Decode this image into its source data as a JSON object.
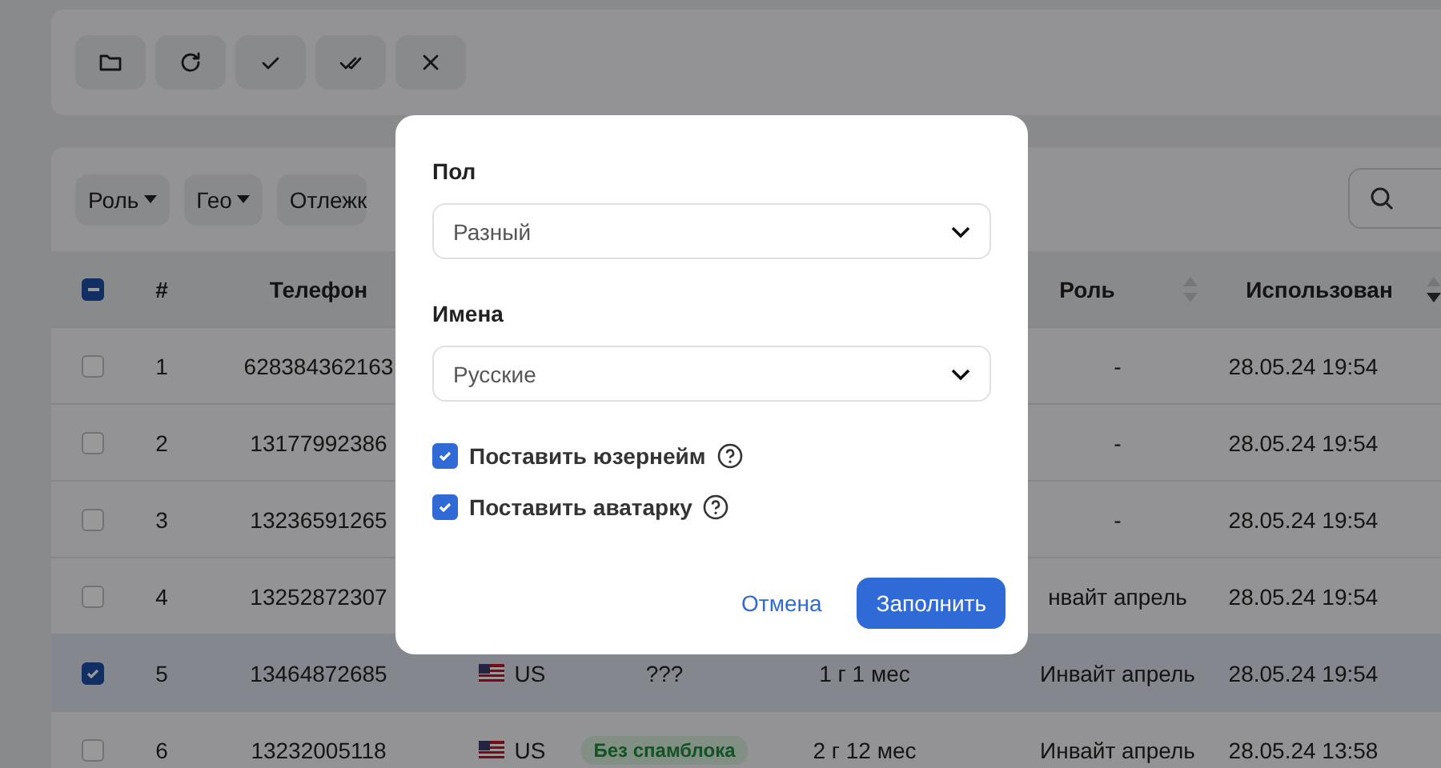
{
  "toolbar": {
    "buttons": [
      {
        "kind": "folder"
      },
      {
        "kind": "refresh"
      },
      {
        "kind": "check"
      },
      {
        "kind": "double-check"
      },
      {
        "kind": "close"
      }
    ]
  },
  "filters": [
    {
      "label": "Роль",
      "dropdown": true
    },
    {
      "label": "Гео",
      "dropdown": true
    },
    {
      "label": "Отлежк",
      "dropdown": false
    }
  ],
  "table": {
    "select_all_indeterminate": true,
    "columns": [
      {
        "label": "#"
      },
      {
        "label": "Телефон"
      },
      {},
      {},
      {},
      {
        "label": "Роль",
        "sorted_descending": false
      },
      {
        "label": "Использован",
        "sorted_descending": true
      }
    ],
    "rows": [
      {
        "selected": false,
        "number": "1",
        "phone": "628384362163",
        "role": "-",
        "used": "28.05.24 19:54"
      },
      {
        "selected": false,
        "number": "2",
        "phone": "13177992386",
        "role": "-",
        "used": "28.05.24 19:54"
      },
      {
        "selected": false,
        "number": "3",
        "phone": "13236591265",
        "role": "-",
        "used": "28.05.24 19:54"
      },
      {
        "selected": false,
        "number": "4",
        "phone": "13252872307",
        "role": "нвайт апрель",
        "used": "28.05.24 19:54"
      },
      {
        "selected": true,
        "number": "5",
        "phone": "13464872685",
        "geo": "US",
        "status": {
          "kind": "plain",
          "text": "???"
        },
        "age": "1 г 1 мес",
        "role": "Инвайт апрель",
        "used": "28.05.24 19:54"
      },
      {
        "selected": false,
        "number": "6",
        "phone": "13232005118",
        "geo": "US",
        "status": {
          "kind": "badge",
          "text": "Без спамблока"
        },
        "age": "2 г 12 мес",
        "role": "Инвайт апрель",
        "used": "28.05.24 13:58"
      }
    ]
  },
  "dialog": {
    "fields": [
      {
        "label": "Пол",
        "value": "Разный"
      },
      {
        "label": "Имена",
        "value": "Русские"
      }
    ],
    "options": [
      {
        "label": "Поставить юзернейм",
        "checked": true
      },
      {
        "label": "Поставить аватарку",
        "checked": true
      }
    ],
    "cancel": "Отмена",
    "submit": "Заполнить"
  }
}
